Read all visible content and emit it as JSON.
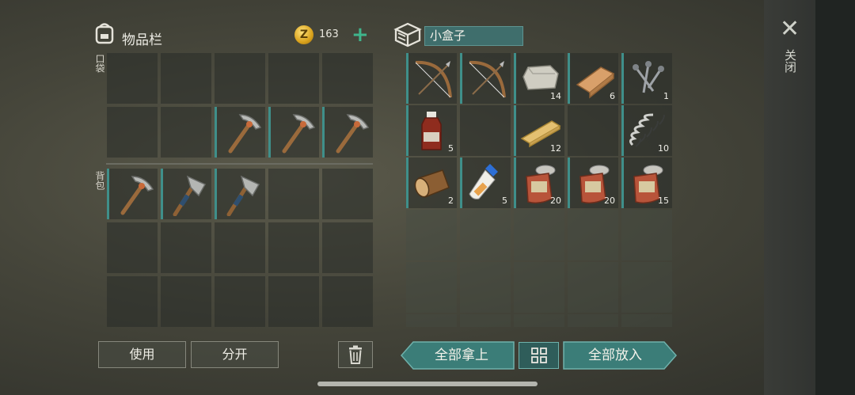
{
  "inventory": {
    "title": "物品栏",
    "coin_symbol": "Z",
    "coin_count": "163",
    "plus_symbol": "+",
    "pocket_label": "口袋",
    "backpack_label": "背包",
    "pocket_slots": [
      {
        "item": "",
        "count": ""
      },
      {
        "item": "",
        "count": ""
      },
      {
        "item": "",
        "count": ""
      },
      {
        "item": "",
        "count": ""
      },
      {
        "item": "",
        "count": ""
      },
      {
        "item": "",
        "count": ""
      },
      {
        "item": "",
        "count": ""
      },
      {
        "item": "pickaxe",
        "count": ""
      },
      {
        "item": "pickaxe",
        "count": ""
      },
      {
        "item": "pickaxe",
        "count": ""
      }
    ],
    "backpack_slots": [
      {
        "item": "pickaxe",
        "count": ""
      },
      {
        "item": "hatchet",
        "count": ""
      },
      {
        "item": "hatchet",
        "count": ""
      },
      {
        "item": "",
        "count": ""
      },
      {
        "item": "",
        "count": ""
      },
      {
        "item": "",
        "count": ""
      },
      {
        "item": "",
        "count": ""
      },
      {
        "item": "",
        "count": ""
      },
      {
        "item": "",
        "count": ""
      },
      {
        "item": "",
        "count": ""
      },
      {
        "item": "",
        "count": ""
      },
      {
        "item": "",
        "count": ""
      },
      {
        "item": "",
        "count": ""
      },
      {
        "item": "",
        "count": ""
      },
      {
        "item": "",
        "count": ""
      }
    ]
  },
  "container": {
    "name": "小盒子",
    "slots": [
      {
        "item": "bow",
        "count": ""
      },
      {
        "item": "bow",
        "count": ""
      },
      {
        "item": "stone",
        "count": "14"
      },
      {
        "item": "plank",
        "count": "6"
      },
      {
        "item": "nails",
        "count": "1"
      },
      {
        "item": "bottle",
        "count": "5"
      },
      {
        "item": "",
        "count": ""
      },
      {
        "item": "board",
        "count": "12"
      },
      {
        "item": "",
        "count": ""
      },
      {
        "item": "spring",
        "count": "10"
      },
      {
        "item": "log",
        "count": "2"
      },
      {
        "item": "glue",
        "count": "5"
      },
      {
        "item": "can",
        "count": "20"
      },
      {
        "item": "can",
        "count": "20"
      },
      {
        "item": "can",
        "count": "15"
      }
    ]
  },
  "buttons": {
    "use": "使用",
    "split": "分开",
    "take_all": "全部拿上",
    "put_all": "全部放入"
  },
  "close_label": "关闭",
  "colors": {
    "accent": "#3f8f8a",
    "coin": "#d9a21c",
    "plus": "#3fb58c"
  }
}
